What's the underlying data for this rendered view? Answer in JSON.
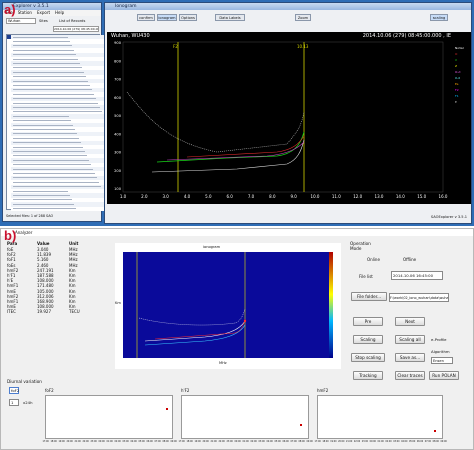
{
  "labels": {
    "a": "a)",
    "b": "b)"
  },
  "explorer": {
    "title": "Explorer v 3.5.1",
    "menu": [
      "File",
      "Station",
      "Export",
      "Help"
    ],
    "station_label": "Wuhan",
    "tabs": [
      "Sites",
      "List of Records"
    ],
    "date_value": "2014.10.06 (279) 08:45:00.000",
    "footer": "Selected files: 1 of 288 SAO"
  },
  "ionogram": {
    "title": "Ionogram",
    "toolbar": [
      "confirm",
      "ionogram",
      "Options",
      "Data Labels",
      "Zoom",
      "scaling"
    ],
    "header_left": "Wuhan, WU430",
    "header_right": "2014.10.06 (279) 08:45:00.000 , IE",
    "marker_f2": "F2",
    "marker_foe": "10.13",
    "legend": [
      "NoVal",
      "O",
      "X",
      "Z",
      "O-d",
      "X-d",
      "Es",
      "F2",
      "F1",
      "E"
    ],
    "xticks": [
      "1.0",
      "2.0",
      "3.0",
      "4.0",
      "5.0",
      "6.0",
      "7.0",
      "8.0",
      "9.0",
      "10.0",
      "11.0",
      "12.0",
      "13.0",
      "14.0",
      "15.0",
      "16.0"
    ],
    "yticks": [
      "900",
      "800",
      "700",
      "600",
      "500",
      "400",
      "300",
      "200",
      "100"
    ],
    "status_right": "SAOExplorer v 3.5.1"
  },
  "analyzer": {
    "title": "Analyzer",
    "params_header": [
      "Para",
      "Value",
      "Unit"
    ],
    "params": [
      [
        "foE",
        "3.040",
        "MHz"
      ],
      [
        "foF2",
        "11.839",
        "MHz"
      ],
      [
        "foF1",
        "5.160",
        "MHz"
      ],
      [
        "foEs",
        "2.460",
        "MHz"
      ],
      [
        "hmF2",
        "247.191",
        "Km"
      ],
      [
        "h'F1",
        "187.588",
        "Km"
      ],
      [
        "h'E",
        "108.000",
        "Km"
      ],
      [
        "hmF1",
        "171.480",
        "Km"
      ],
      [
        "hmE",
        "105.000",
        "Km"
      ],
      [
        "hmF2",
        "312.006",
        "Km"
      ],
      [
        "hmF1",
        "168.900",
        "Km"
      ],
      [
        "hmE",
        "108.000",
        "Km"
      ],
      [
        "ITEC",
        "19.927",
        "TECU"
      ]
    ],
    "chart_title": "ionogram",
    "xlabel": "MHz",
    "ylabel": "Km",
    "mode_group": "Operation Mode",
    "online_label": "Online",
    "offline_label": "Offline",
    "file_list_label": "File list",
    "file_list_value": "2014.10.06 16:45:00",
    "file_folder_btn": "File folder...",
    "file_name": "F:\\work\\02_iono_wuhan\\data\\wuhan",
    "buttons": [
      "Pre",
      "Next",
      "Scaling",
      "Scaling all",
      "Stop scaling",
      "Save as...",
      "Tracking",
      "Clear traces",
      "Run POLAN"
    ],
    "eprofile_label": "e-Profile",
    "algorithm_label": "Algorithm",
    "algorithm_value": "Ensen",
    "diurnal_label": "Diurnal variation",
    "diurnal_select": "foF2",
    "day_select": "1",
    "day_unit": "x24h",
    "diurnal_titles": [
      "foF2",
      "h'F2",
      "hmF2"
    ],
    "diurnal_xticks": [
      "17:00",
      "18:00",
      "19:00",
      "20:00",
      "21:00",
      "22:00",
      "23:00",
      "00:00",
      "01:00",
      "02:00",
      "03:00",
      "04:00",
      "05:00",
      "06:00",
      "07:00",
      "08:00",
      "09:00"
    ]
  }
}
